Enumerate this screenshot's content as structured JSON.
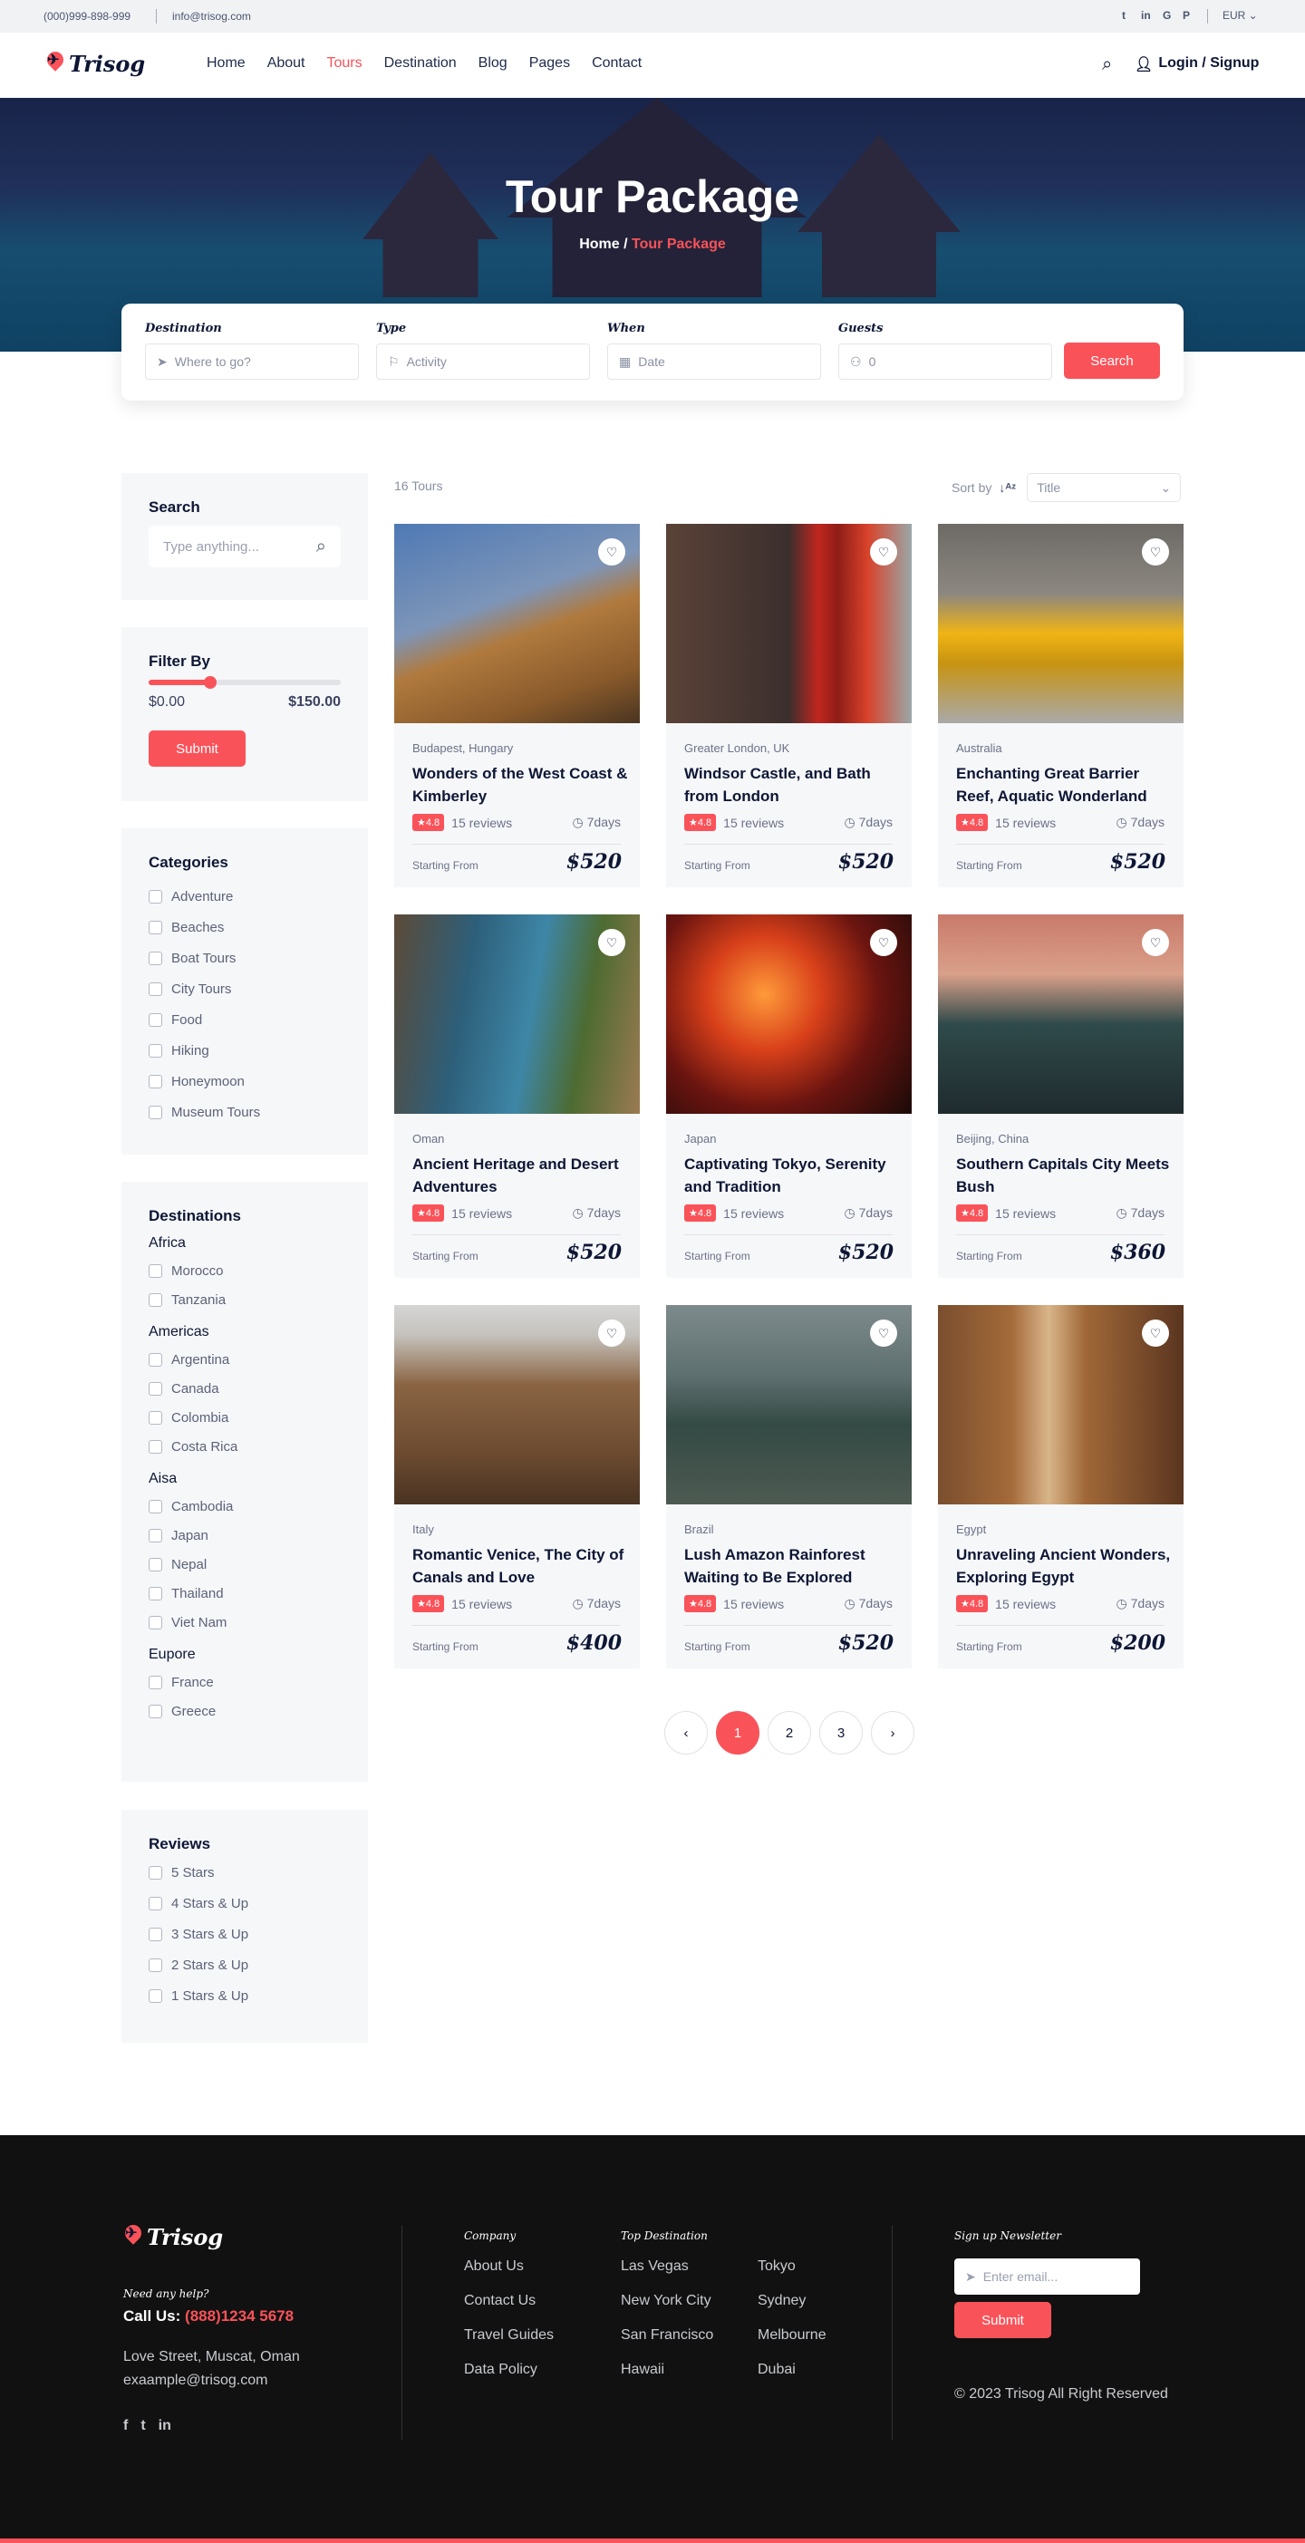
{
  "topbar": {
    "phone": "(000)999-898-999",
    "email": "info@trisog.com",
    "social": [
      "t",
      "in",
      "G",
      "P"
    ],
    "currency": "EUR"
  },
  "brand": "Trisog",
  "nav": {
    "items": [
      "Home",
      "About",
      "Tours",
      "Destination",
      "Blog",
      "Pages",
      "Contact"
    ],
    "active": "Tours",
    "login": "Login / Signup"
  },
  "hero": {
    "title": "Tour Package",
    "crumb_home": "Home /",
    "crumb_current": "Tour Package"
  },
  "search": {
    "fields": [
      {
        "label": "Destination",
        "placeholder": "Where to go?",
        "icon": "➤"
      },
      {
        "label": "Type",
        "placeholder": "Activity",
        "icon": "⚐"
      },
      {
        "label": "When",
        "placeholder": "Date",
        "icon": "▦"
      },
      {
        "label": "Guests",
        "placeholder": "0",
        "icon": "⚇"
      }
    ],
    "button": "Search"
  },
  "sidebar": {
    "search_title": "Search",
    "search_placeholder": "Type anything...",
    "filter_title": "Filter By",
    "price_min": "$0.00",
    "price_max": "$150.00",
    "price_fraction": 0.32,
    "filter_button": "Submit",
    "categories_title": "Categories",
    "categories": [
      "Adventure",
      "Beaches",
      "Boat Tours",
      "City Tours",
      "Food",
      "Hiking",
      "Honeymoon",
      "Museum Tours"
    ],
    "destinations_title": "Destinations",
    "destinations": [
      {
        "group": "Africa",
        "items": [
          "Morocco",
          "Tanzania"
        ]
      },
      {
        "group": "Americas",
        "items": [
          "Argentina",
          "Canada",
          "Colombia",
          "Costa Rica"
        ]
      },
      {
        "group": "Aisa",
        "items": [
          "Cambodia",
          "Japan",
          "Nepal",
          "Thailand",
          "Viet Nam"
        ]
      },
      {
        "group": "Eupore",
        "items": [
          "France",
          "Greece"
        ]
      }
    ],
    "reviews_title": "Reviews",
    "reviews": [
      "5 Stars",
      "4 Stars & Up",
      "3 Stars & Up",
      "2 Stars & Up",
      "1 Stars & Up"
    ]
  },
  "listing": {
    "count": "16 Tours",
    "sort_label": "Sort by",
    "sort_value": "Title"
  },
  "tours": [
    {
      "location": "Budapest, Hungary",
      "title": "Wonders of the West Coast & Kimberley",
      "rating": "4.8",
      "reviews": "15 reviews",
      "duration": "7days",
      "from": "Starting From",
      "price": "$520",
      "bg": "linear-gradient(160deg,#4f79b5 0%,#7d95b8 40%,#b07a3e 55%,#8a5a2b 80%,#4a3520 100%)"
    },
    {
      "location": "Greater London, UK",
      "title": "Windsor Castle, and Bath from London",
      "rating": "4.8",
      "reviews": "15 reviews",
      "duration": "7days",
      "from": "Starting From",
      "price": "$520",
      "bg": "linear-gradient(90deg,#5a4238 0%,#3b2f2d 50%,#c0261f 62%,#8f1d18 70%,#d8422a 82%,#9aa8a8 100%)"
    },
    {
      "location": "Australia",
      "title": "Enchanting Great Barrier Reef, Aquatic Wonderland",
      "rating": "4.8",
      "reviews": "15 reviews",
      "duration": "7days",
      "from": "Starting From",
      "price": "$520",
      "bg": "linear-gradient(180deg,#6d6a66 0%,#8c8780 35%,#f0b414 55%,#c79412 70%,#a9a9a9 100%)"
    },
    {
      "location": "Oman",
      "title": "Ancient Heritage and Desert Adventures",
      "rating": "4.8",
      "reviews": "15 reviews",
      "duration": "7days",
      "from": "Starting From",
      "price": "$520",
      "bg": "linear-gradient(100deg,#5c4a38 0%,#2d5f7a 30%,#3e86a6 55%,#4d6b32 75%,#9b7a52 100%)"
    },
    {
      "location": "Japan",
      "title": "Captivating Tokyo, Serenity and Tradition",
      "rating": "4.8",
      "reviews": "15 reviews",
      "duration": "7days",
      "from": "Starting From",
      "price": "$520",
      "bg": "radial-gradient(circle at 40% 40%,#ff9a3a 0%,#d8401a 30%,#6a1410 60%,#1a0a08 100%)"
    },
    {
      "location": "Beijing, China",
      "title": "Southern Capitals City Meets Bush",
      "rating": "4.8",
      "reviews": "15 reviews",
      "duration": "7days",
      "from": "Starting From",
      "price": "$360",
      "bg": "linear-gradient(180deg,#c97a6a 0%,#d9a08a 30%,#2f4a4a 55%,#1f2b2e 100%)"
    },
    {
      "location": "Italy",
      "title": "Romantic Venice, The City of Canals and Love",
      "rating": "4.8",
      "reviews": "15 reviews",
      "duration": "7days",
      "from": "Starting From",
      "price": "$400",
      "bg": "linear-gradient(180deg,#d5d5d5 0%,#c5c2bd 15%,#8a6443 40%,#6b4a30 75%,#4a3322 100%)"
    },
    {
      "location": "Brazil",
      "title": "Lush Amazon Rainforest Waiting to Be Explored",
      "rating": "4.8",
      "reviews": "15 reviews",
      "duration": "7days",
      "from": "Starting From",
      "price": "$520",
      "bg": "linear-gradient(180deg,#7d8a8c 0%,#5f7070 35%,#344a44 60%,#4d5a52 100%)"
    },
    {
      "location": "Egypt",
      "title": "Unraveling Ancient Wonders, Exploring Egypt",
      "rating": "4.8",
      "reviews": "15 reviews",
      "duration": "7days",
      "from": "Starting From",
      "price": "$200",
      "bg": "linear-gradient(90deg,#7a4e2e 0%,#a46a3a 30%,#d9b58a 45%,#a06838 60%,#5a3520 100%)"
    }
  ],
  "pagination": {
    "pages": [
      "1",
      "2",
      "3"
    ],
    "current": "1",
    "prev": "‹",
    "next": "›"
  },
  "footer": {
    "help": "Need any help?",
    "call_label": "Call Us:",
    "phone": "(888)1234 5678",
    "address": "Love Street, Muscat, Oman",
    "email": "exaample@trisog.com",
    "social": [
      "f",
      "t",
      "in"
    ],
    "company_title": "Company",
    "company": [
      "About Us",
      "Contact Us",
      "Travel Guides",
      "Data Policy"
    ],
    "dest_title": "Top Destination",
    "dest_col1": [
      "Las Vegas",
      "New York City",
      "San Francisco",
      "Hawaii"
    ],
    "dest_col2": [
      "Tokyo",
      "Sydney",
      "Melbourne",
      "Dubai"
    ],
    "newsletter_title": "Sign up Newsletter",
    "email_placeholder": "Enter email...",
    "submit": "Submit",
    "copyright": "© 2023 Trisog All Right Reserved"
  },
  "colors": {
    "accent": "#fa5259",
    "dark": "#0d1634",
    "footer": "#111111"
  }
}
